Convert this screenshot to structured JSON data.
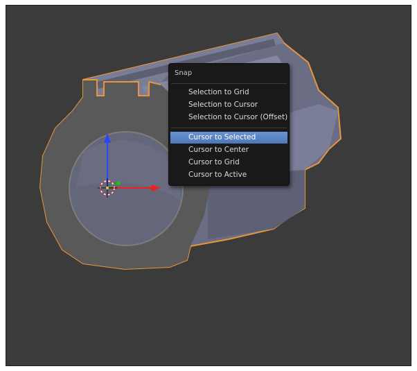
{
  "snap_menu": {
    "title": "Snap",
    "items": [
      {
        "label": "Selection to Grid"
      },
      {
        "label": "Selection to Cursor"
      },
      {
        "label": "Selection to Cursor (Offset)"
      },
      {
        "label": "Cursor to Selected",
        "highlighted": true
      },
      {
        "label": "Cursor to Center"
      },
      {
        "label": "Cursor to Grid"
      },
      {
        "label": "Cursor to Active"
      }
    ]
  },
  "colors": {
    "viewport_bg": "#3b3b3b",
    "mesh_fill": "#6d6f86",
    "mesh_shadow": "#55576a",
    "selection_outline": "#e89a3c",
    "menu_bg": "#191919",
    "menu_highlight": "#5a83c5",
    "axis_z": "#2244ff",
    "axis_x": "#ee2222",
    "axis_y": "#22aa22"
  }
}
